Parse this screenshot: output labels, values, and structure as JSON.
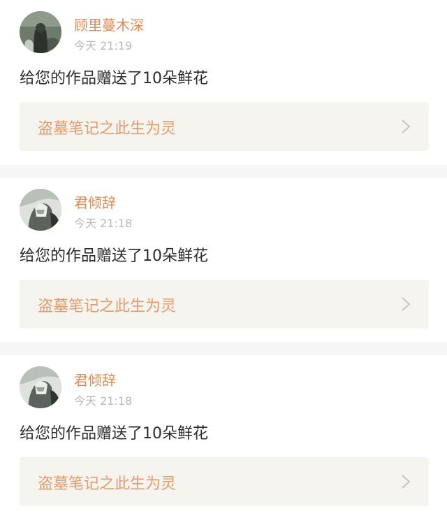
{
  "notifications": [
    {
      "username": "顾里蔓木深",
      "time": "今天 21:19",
      "message": "给您的作品赠送了10朵鲜花",
      "work_title": "盗墓笔记之此生为灵",
      "avatar_icon": "avatar-dark-figure"
    },
    {
      "username": "君倾辞",
      "time": "今天 21:18",
      "message": "给您的作品赠送了10朵鲜花",
      "work_title": "盗墓笔记之此生为灵",
      "avatar_icon": "avatar-ink-figure"
    },
    {
      "username": "君倾辞",
      "time": "今天 21:18",
      "message": "给您的作品赠送了10朵鲜花",
      "work_title": "盗墓笔记之此生为灵",
      "avatar_icon": "avatar-ink-figure"
    }
  ],
  "colors": {
    "username": "#e08a52",
    "work_title": "#e59a6b",
    "time": "#b8b8b8",
    "link_bg": "#f5f4ee",
    "divider": "#f6f6f6"
  }
}
